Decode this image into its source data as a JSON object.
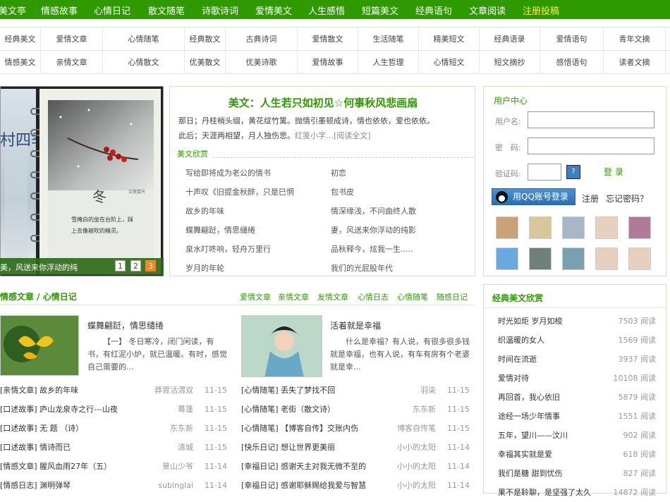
{
  "topnav": [
    "美文亭",
    "情感故事",
    "心情日记",
    "散文随笔",
    "诗歌诗词",
    "爱情美文",
    "人生感悟",
    "短篇美文",
    "经典语句",
    "文章阅读",
    "注册投稿"
  ],
  "categories": {
    "row1": [
      "经典美文",
      "爱情文章",
      "心情随笔",
      "经典散文",
      "古典诗词",
      "爱情散文",
      "生活随笔",
      "精美短文",
      "经典语录",
      "爱情语句",
      "青年文摘"
    ],
    "row2": [
      "情感美文",
      "亲情文章",
      "心情散文",
      "优美散文",
      "优美诗歌",
      "爱情故事",
      "人生哲理",
      "心情短文",
      "短文摘抄",
      "感悟语句",
      "读者文摘"
    ]
  },
  "slideshow": {
    "vertical_title": "山村四季",
    "stamp": "冬",
    "signature": "文斋壹尺",
    "poem_line1": "雪掩白的坐在台阶上，踩",
    "poem_line2": "上去像被吹的精灵。",
    "caption": "美，风送来你浮动的纯",
    "pages": [
      "1",
      "2",
      "3"
    ],
    "active_page": "3"
  },
  "feature": {
    "title": "美文：人生若只如初见☆何事秋风悲画扇",
    "line1": "那日；丹桂梢头缀，黄花绽竹篱。抛情引墨顿成诗，情也依依，爱也依依。",
    "line2a": "此后；天涯两相望，月人独伤悲。",
    "line2b": "红笺小字…[阅读全文]",
    "section": "美文欣赏",
    "left_articles": [
      "写给即将成为老公的情书",
      "十声叹《旧提金秋醉，只是巳惘",
      "故乡的年味",
      "蝶舞翩跹，情思缱绻",
      "泉水叮咚响，轻舟万里行",
      "岁月的年轮"
    ],
    "right_articles": [
      "初恋",
      "包书皮",
      "情深缘浅，不问曲终人散",
      "妻，风送来你浮动的纯影",
      "品秋释今，炫我一生.....",
      "我们的光屁股年代"
    ]
  },
  "user_center": {
    "title": "用户中心",
    "username_label": "用户名:",
    "password_label": "密　码:",
    "captcha_label": "验证码:",
    "login": "登 录",
    "qq_login": "用QQ账号登录",
    "register": "注册",
    "forgot": "忘记密码？",
    "avatar_colors": [
      "#c9a27a",
      "#d8c79a",
      "#a8b7c8",
      "#e8d0c0",
      "#b07a9a",
      "#6aa8e0",
      "#6f7f7a",
      "#7aa0b0",
      "#e8d0c0",
      "#e8d0c0"
    ]
  },
  "emotion_section": {
    "title": "情感文章 / 心情日记",
    "tabs": [
      "爱情文章",
      "亲情文章",
      "友情文章",
      "心情日志",
      "心情随笔",
      "随感日记"
    ],
    "post1": {
      "title": "蝶舞翩跹，情思缱绻",
      "excerpt": "【一】 冬日寒冷，闭门闲读，有书，有红泥小炉，就已温暖。有时，感觉自己需要的..."
    },
    "post2": {
      "title": "活着就是幸福",
      "excerpt": "什么是幸福？有人说，有很多很多钱就是幸福，也有人说，有车有房有个老婆就是幸..."
    },
    "left_list": [
      {
        "title": "[亲情文章] 故乡的年味",
        "author": "莽胃活渭双",
        "date": "11-15"
      },
      {
        "title": "[口述故事] 庐山龙泉寺之行---山夜",
        "author": "蓦蓬",
        "date": "11-15"
      },
      {
        "title": "[口述故事] 无 题 （诗）",
        "author": "东东新",
        "date": "11-15"
      },
      {
        "title": "[口述故事] 情诗而已",
        "author": "清城",
        "date": "11-15"
      },
      {
        "title": "[情感文章] 腥风血雨27年（五）",
        "author": "景山少爷",
        "date": "11-14"
      },
      {
        "title": "[情感日志] 渊明弹琴",
        "author": "subinglai",
        "date": "11-14"
      }
    ],
    "right_list": [
      {
        "title": "[心情随笔] 丢失了梦找不回",
        "author": "羽柒",
        "date": "11-15"
      },
      {
        "title": "[心情随笔] 老街（散文诗）",
        "author": "东东新",
        "date": "11-15"
      },
      {
        "title": "[心情随笔] 【博客自传】交账内伤",
        "author": "博客自传笔",
        "date": "11-15"
      },
      {
        "title": "[快乐日记] 想让世界更美丽",
        "author": "小小的太阳",
        "date": "11-14"
      },
      {
        "title": "[幸福日记] 感谢天主对我无微不至的",
        "author": "小小的太阳",
        "date": "11-14"
      },
      {
        "title": "[幸福日记] 感谢耶稣赐给我爱与智慧",
        "author": "小小的太阳",
        "date": "11-14"
      }
    ]
  },
  "classic": {
    "title": "经典美文欣赏",
    "read_label": "阅读",
    "items": [
      {
        "name": "时光如炬 岁月如梭",
        "count": "7503"
      },
      {
        "name": "织温暖的女人",
        "count": "1569"
      },
      {
        "name": "时间在流逝",
        "count": "3937"
      },
      {
        "name": "爱情对待",
        "count": "10108"
      },
      {
        "name": "再回首，我心依旧",
        "count": "5879"
      },
      {
        "name": "途经一场少年情事",
        "count": "1551"
      },
      {
        "name": "五年，望川——汶川",
        "count": "902"
      },
      {
        "name": "幸福其实就是爱",
        "count": "618"
      },
      {
        "name": "我们是糖 甜到忧伤",
        "count": "827"
      },
      {
        "name": "果不是聆聊，是坚强了太久",
        "count": "14872"
      }
    ]
  }
}
